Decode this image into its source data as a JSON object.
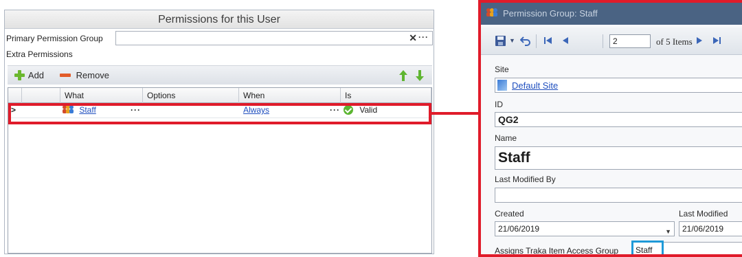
{
  "permissions_panel": {
    "title": "Permissions for this User",
    "primary_group_label": "Primary Permission Group",
    "primary_group_value": "",
    "clear_glyph": "✕",
    "more_glyph": "···",
    "extra_label": "Extra Permissions",
    "toolbar": {
      "add_label": "Add",
      "remove_label": "Remove"
    },
    "grid": {
      "columns": [
        "What",
        "Options",
        "When",
        "Is"
      ],
      "rows": [
        {
          "indicator": ">",
          "what": "Staff",
          "what_ellipsis": "···",
          "options": "",
          "when": "Always",
          "when_ellipsis": "···",
          "is": "Valid"
        }
      ]
    }
  },
  "detail_panel": {
    "title": "Permission Group: Staff",
    "toolbar": {
      "page_value": "2",
      "of_items": "of 5 Items",
      "dropdown_glyph": "▼"
    },
    "fields": {
      "site_label": "Site",
      "site_value": "Default Site",
      "id_label": "ID",
      "id_value": "QG2",
      "name_label": "Name",
      "name_value": "Staff",
      "last_modified_by_label": "Last Modified By",
      "last_modified_by_value": "",
      "created_label": "Created",
      "created_value": "21/06/2019",
      "last_modified_label": "Last Modified",
      "last_modified_value": "21/06/2019",
      "assigns_label": "Assigns Traka Item Access Group",
      "assigns_value": "Staff"
    }
  },
  "colors": {
    "highlight_red": "#e01b2a",
    "highlight_blue": "#1f9ad8",
    "titlebar": "#4a6383",
    "link": "#1f4fbf",
    "valid_green": "#5cb531"
  },
  "icons": [
    "plus-icon",
    "minus-icon",
    "arrow-up-icon",
    "arrow-down-icon",
    "group-icon",
    "valid-check-icon",
    "save-icon",
    "undo-icon",
    "first-record-icon",
    "previous-record-icon",
    "next-record-icon",
    "last-record-icon",
    "site-icon"
  ]
}
